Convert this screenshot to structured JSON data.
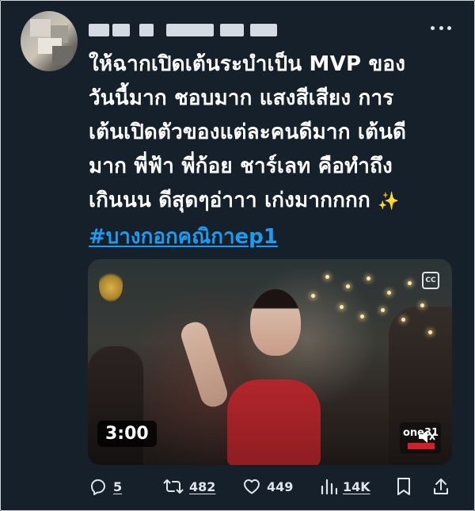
{
  "tweet": {
    "text_lines": [
      "ให้ฉากเปิดเต้นระบำเป็น MVP ของ",
      "วันนี้มาก ชอบมาก แสงสีเสียง การ",
      "เต้นเปิดตัวของแต่ละคนดีมาก เต้นดี",
      "มาก พี่ฟ้า พี่ก้อย ชาร์เลท คือทำถึง",
      "เกินนน ดีสุดๆอ่าาา เก่งมากกกก"
    ],
    "sparkle_emoji": "✨",
    "hashtag": "#บางกอกคณิกาep1"
  },
  "media": {
    "duration": "3:00",
    "cc_label": "CC",
    "channel_logo_text": "one31"
  },
  "actions": {
    "replies": "5",
    "retweets": "482",
    "likes": "449",
    "views": "14K"
  },
  "colors": {
    "background": "#15202b",
    "hashtag": "#1d9bf0",
    "text": "#ffffff",
    "icon": "#dfe5ea"
  },
  "icons": {
    "more": "more-dots-icon",
    "reply": "reply-bubble-icon",
    "retweet": "retweet-icon",
    "like": "heart-icon",
    "views": "bar-chart-icon",
    "bookmark": "bookmark-icon",
    "share": "share-icon",
    "mute": "speaker-muted-icon"
  }
}
